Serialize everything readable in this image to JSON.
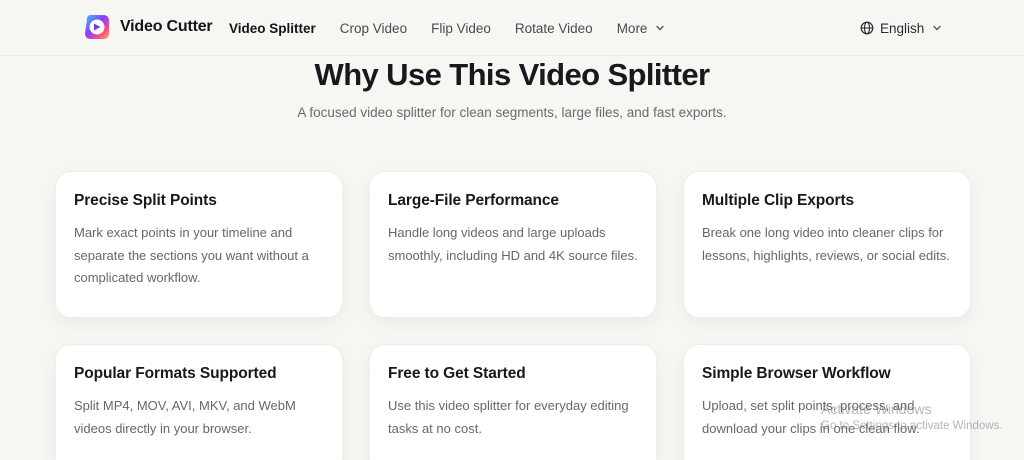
{
  "header": {
    "brand_name": "Video Cutter",
    "nav": [
      {
        "label": "Video Splitter",
        "active": true
      },
      {
        "label": "Crop Video"
      },
      {
        "label": "Flip Video"
      },
      {
        "label": "Rotate Video"
      },
      {
        "label": "More"
      }
    ],
    "language": "English"
  },
  "main": {
    "title": "Why Use This Video Splitter",
    "subtitle": "A focused video splitter for clean segments, large files, and fast exports.",
    "cards": [
      {
        "title": "Precise Split Points",
        "text": "Mark exact points in your timeline and separate the sections you want without a complicated workflow."
      },
      {
        "title": "Large-File Performance",
        "text": "Handle long videos and large uploads smoothly, including HD and 4K source files."
      },
      {
        "title": "Multiple Clip Exports",
        "text": "Break one long video into cleaner clips for lessons, highlights, reviews, or social edits."
      },
      {
        "title": "Popular Formats Supported",
        "text": "Split MP4, MOV, AVI, MKV, and WebM videos directly in your browser."
      },
      {
        "title": "Free to Get Started",
        "text": "Use this video splitter for everyday editing tasks at no cost."
      },
      {
        "title": "Simple Browser Workflow",
        "text": "Upload, set split points, process, and download your clips in one clean flow."
      }
    ]
  },
  "watermark": {
    "line1": "Activate Windows",
    "line2": "Go to Settings to activate Windows."
  },
  "colors": {
    "background": "#f6f6f3",
    "card": "#ffffff",
    "logo_gradient": [
      "#2fc7ff",
      "#8a3dff",
      "#ff4d8d",
      "#ffb23f"
    ]
  },
  "icons": [
    "video-cutter-logo-icon",
    "chevron-down-icon",
    "globe-icon"
  ]
}
